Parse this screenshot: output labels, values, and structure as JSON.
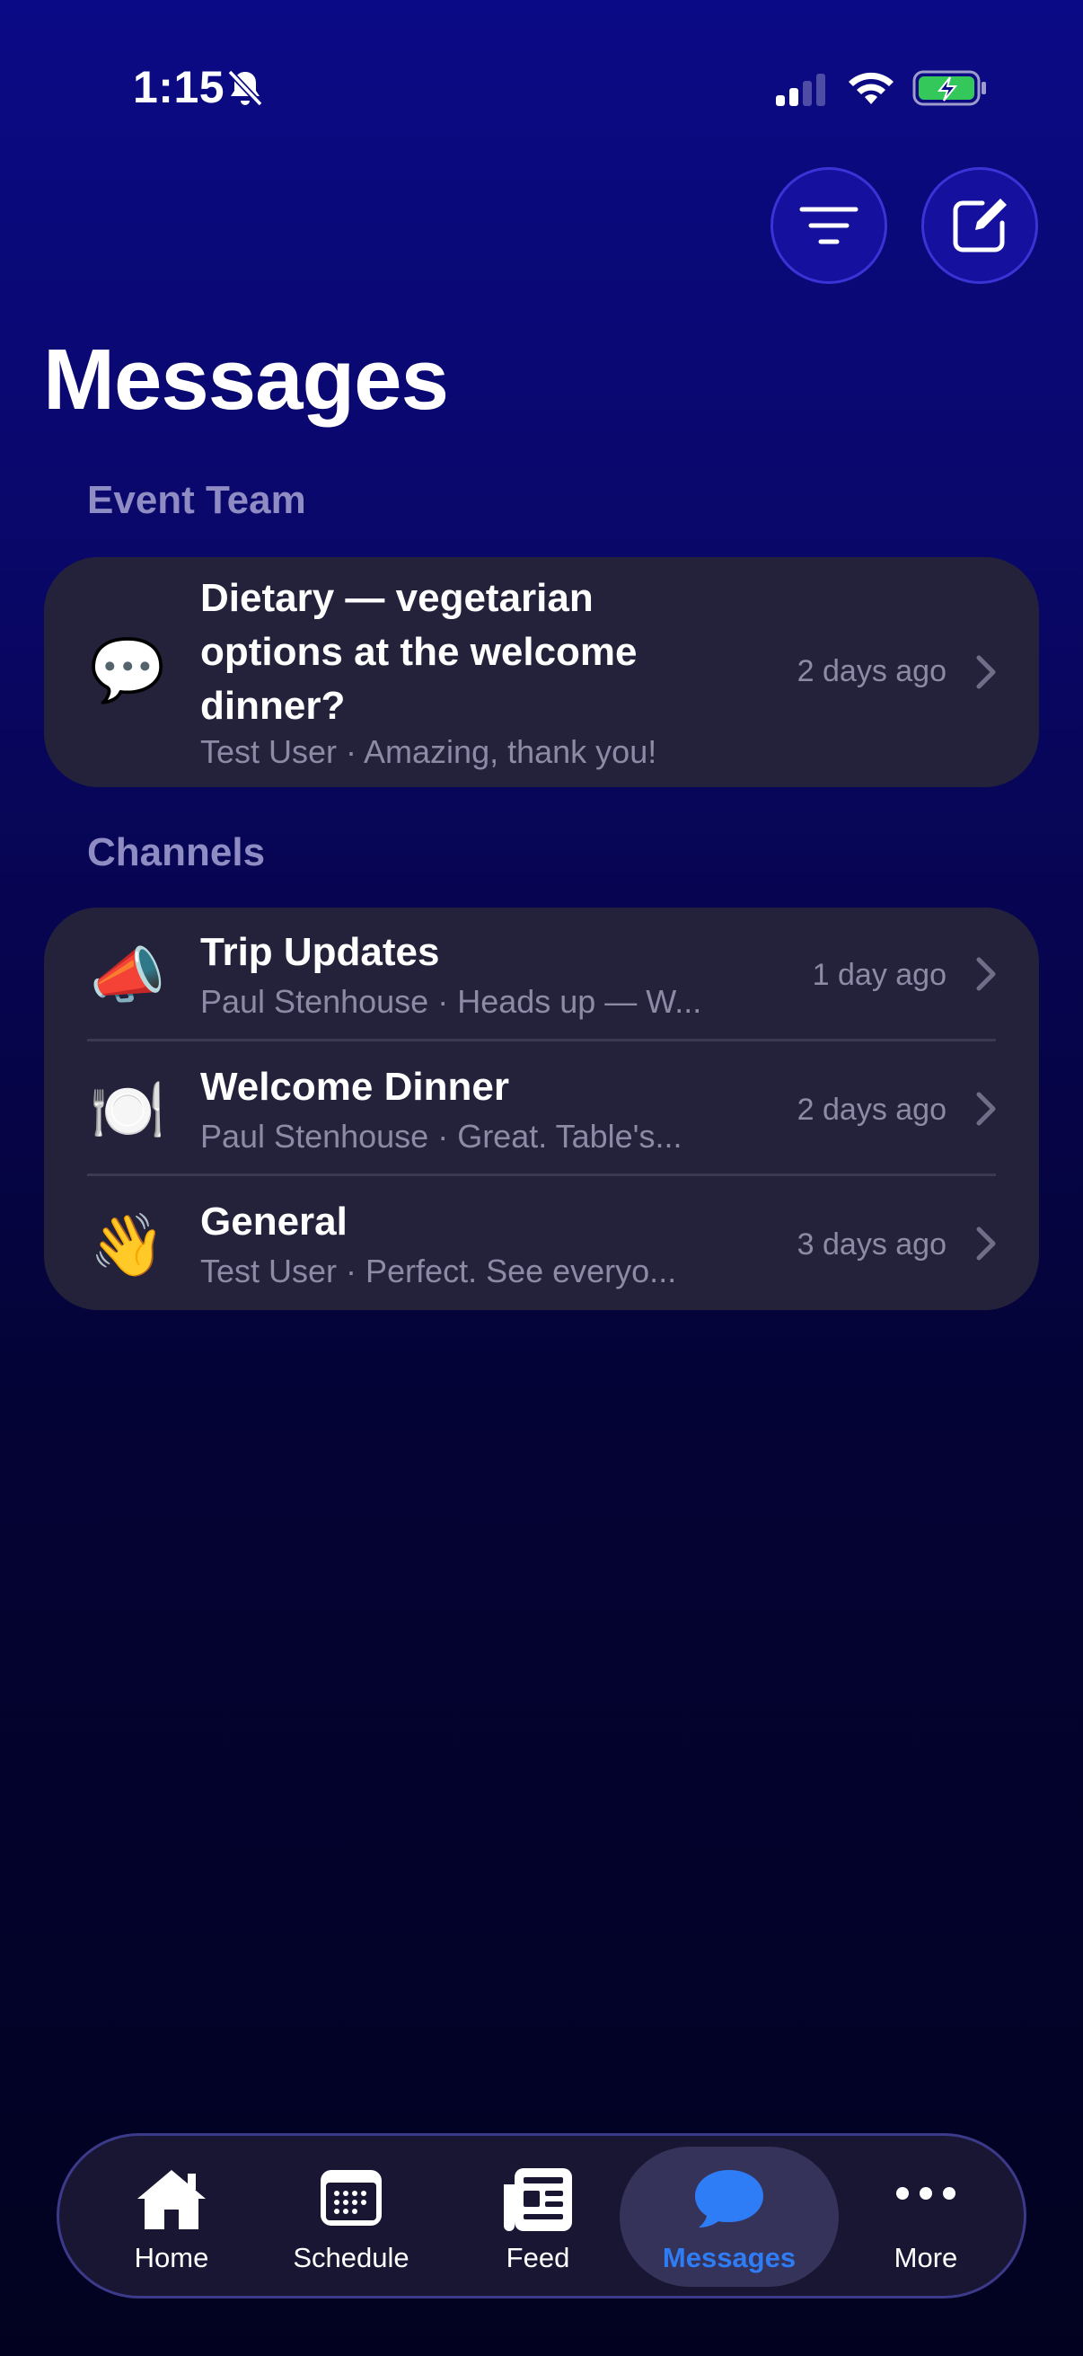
{
  "status_bar": {
    "time": "1:15"
  },
  "header": {
    "title": "Messages"
  },
  "sections": {
    "event_team": {
      "header": "Event Team",
      "items": [
        {
          "icon": "💬",
          "title_line1": "Dietary — vegetarian",
          "title_line2": "options at the welcome",
          "title_line3": "dinner?",
          "subtitle": "Test User · Amazing, thank you!",
          "time": "2 days ago"
        }
      ]
    },
    "channels": {
      "header": "Channels",
      "items": [
        {
          "icon": "📣",
          "title": "Trip Updates",
          "subtitle": "Paul Stenhouse · Heads up — W...",
          "time": "1 day ago"
        },
        {
          "icon": "🍽️",
          "title": "Welcome Dinner",
          "subtitle": "Paul Stenhouse · Great. Table's...",
          "time": "2 days ago"
        },
        {
          "icon": "👋",
          "title": "General",
          "subtitle": "Test User · Perfect. See everyo...",
          "time": "3 days ago"
        }
      ]
    }
  },
  "tab_bar": {
    "tabs": [
      {
        "label": "Home",
        "icon": "house-icon"
      },
      {
        "label": "Schedule",
        "icon": "calendar-icon"
      },
      {
        "label": "Feed",
        "icon": "newspaper-icon"
      },
      {
        "label": "Messages",
        "icon": "chat-bubble-icon"
      },
      {
        "label": "More",
        "icon": "ellipsis-icon"
      }
    ],
    "active": "Messages"
  },
  "colors": {
    "accent": "#2f7df6",
    "card": "#24223b",
    "secondary_text": "#8d8aa6",
    "section_header": "#8f8cc4",
    "button": "#15109e"
  }
}
